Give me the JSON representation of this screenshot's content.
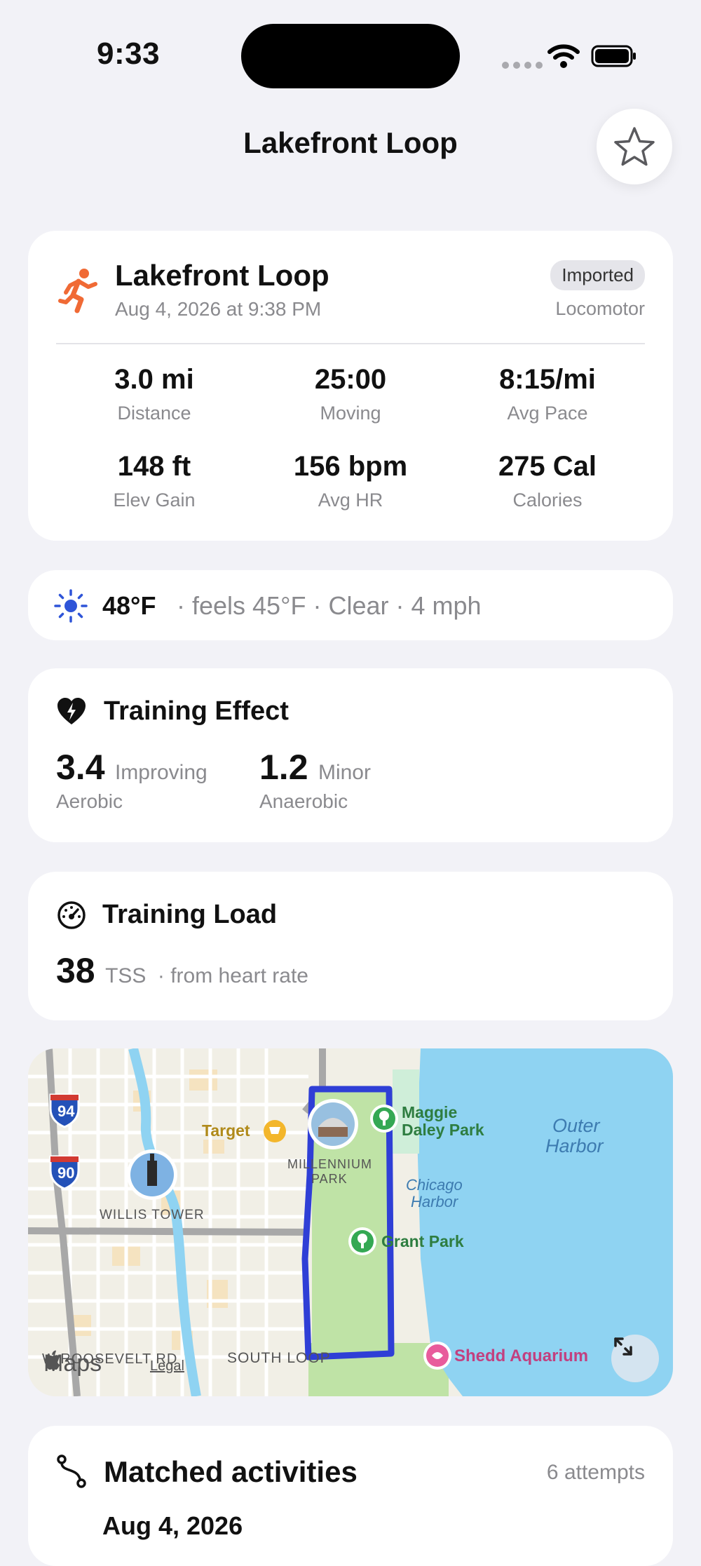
{
  "status_bar": {
    "time": "9:33"
  },
  "nav": {
    "title": "Lakefront Loop",
    "favorite_icon": "star-icon"
  },
  "activity": {
    "icon": "running-figure-icon",
    "title": "Lakefront Loop",
    "date": "Aug 4, 2026 at 9:38 PM",
    "badge": "Imported",
    "source": "Locomotor",
    "stats": [
      {
        "value": "3.0 mi",
        "label": "Distance"
      },
      {
        "value": "25:00",
        "label": "Moving"
      },
      {
        "value": "8:15/mi",
        "label": "Avg Pace"
      },
      {
        "value": "148 ft",
        "label": "Elev Gain"
      },
      {
        "value": "156 bpm",
        "label": "Avg HR"
      },
      {
        "value": "275 Cal",
        "label": "Calories"
      }
    ]
  },
  "weather": {
    "icon": "sun-icon",
    "temp": "48°F",
    "details": "· feels 45°F  · Clear  · 4 mph"
  },
  "training_effect": {
    "title": "Training Effect",
    "aerobic": {
      "value": "3.4",
      "rating": "Improving",
      "label": "Aerobic"
    },
    "anaerobic": {
      "value": "1.2",
      "rating": "Minor",
      "label": "Anaerobic"
    }
  },
  "training_load": {
    "title": "Training Load",
    "value": "38",
    "unit": "TSS",
    "note": "· from heart rate"
  },
  "map": {
    "labels": {
      "i94": "94",
      "i90": "90",
      "target": "Target",
      "willis": "WILLIS TOWER",
      "millennium_1": "MILLENNIUM",
      "millennium_2": "PARK",
      "maggie_1": "Maggie",
      "maggie_2": "Daley Park",
      "harbor_1": "Outer",
      "harbor_2": "Harbor",
      "chicago_1": "Chicago",
      "chicago_2": "Harbor",
      "grant": "Grant Park",
      "roosevelt": "W ROOSEVELT RD",
      "south_loop": "SOUTH LOOP",
      "shedd": "Shedd Aquarium",
      "attribution": "Maps",
      "legal": "Legal"
    },
    "colors": {
      "water": "#8fd3f2",
      "route": "#2f3fd6",
      "park": "#bfe3a6"
    }
  },
  "matched": {
    "title": "Matched activities",
    "count": "6 attempts",
    "first_date": "Aug 4, 2026"
  }
}
